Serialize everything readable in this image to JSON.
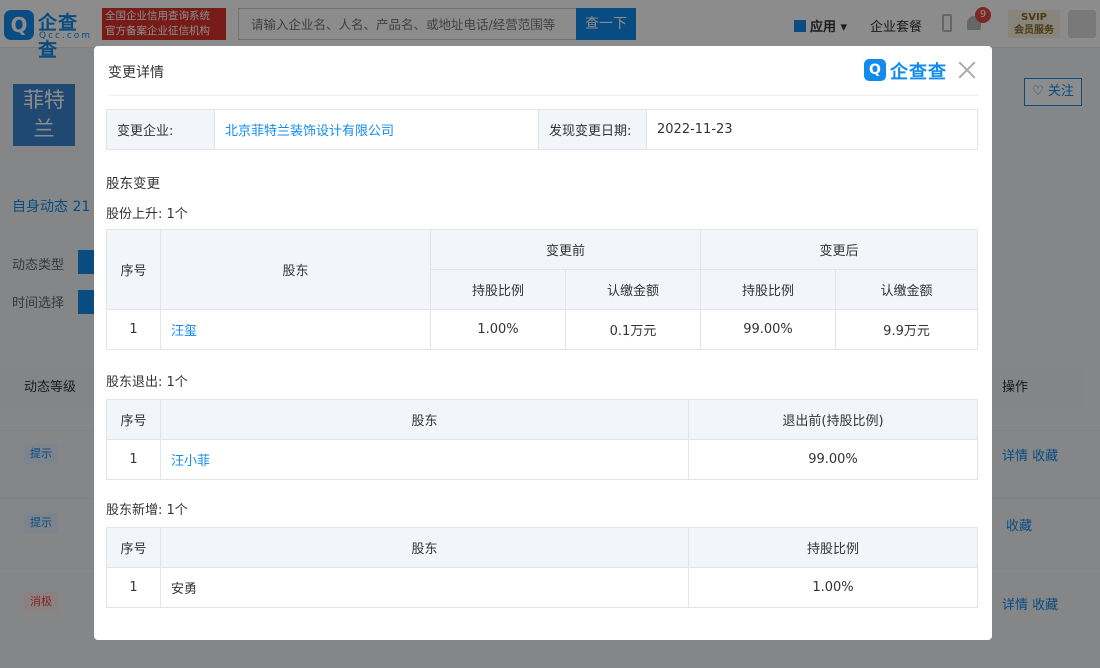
{
  "header": {
    "logo_mark": "Q",
    "logo_cn": "企查查",
    "logo_en": "Qcc.com",
    "badge_line1": "全国企业信用查询系统",
    "badge_line2": "官方备案企业征信机构",
    "search_placeholder": "请输入企业名、人名、产品名、或地址电话/经营范围等",
    "search_button": "查一下",
    "apps_label": "应用 ▾",
    "suite_label": "企业套餐",
    "notification_count": "9",
    "svip_line1": "SVIP",
    "svip_line2": "会员服务"
  },
  "company": {
    "logo_line1": "菲特",
    "logo_line2": "兰",
    "follow_label": "♡ 关注"
  },
  "background": {
    "self_tab": "自身动态 21",
    "filter_type_label": "动态类型",
    "filter_time_label": "时间选择",
    "col_level": "动态等级",
    "col_action": "操作",
    "rows": [
      {
        "level": "提示",
        "actions": "详情 收藏"
      },
      {
        "level": "提示",
        "actions": "收藏"
      },
      {
        "level": "消极",
        "actions": "详情 收藏"
      }
    ]
  },
  "modal": {
    "title": "变更详情",
    "brand_mark": "Q",
    "brand_text": "企查查",
    "info": {
      "company_label": "变更企业:",
      "company_value": "北京菲特兰装饰设计有限公司",
      "date_label": "发现变更日期:",
      "date_value": "2022-11-23"
    },
    "section_title": "股东变更",
    "increase": {
      "title": "股份上升: 1个",
      "col_no": "序号",
      "col_holder": "股东",
      "col_before": "变更前",
      "col_after": "变更后",
      "col_ratio": "持股比例",
      "col_amount": "认缴金额",
      "rows": [
        {
          "no": "1",
          "holder": "汪玺",
          "before_ratio": "1.00%",
          "before_amount": "0.1万元",
          "after_ratio": "99.00%",
          "after_amount": "9.9万元"
        }
      ]
    },
    "exit": {
      "title": "股东退出: 1个",
      "col_no": "序号",
      "col_holder": "股东",
      "col_ratio": "退出前(持股比例)",
      "rows": [
        {
          "no": "1",
          "holder": "汪小菲",
          "ratio": "99.00%"
        }
      ]
    },
    "added": {
      "title": "股东新增: 1个",
      "col_no": "序号",
      "col_holder": "股东",
      "col_ratio": "持股比例",
      "rows": [
        {
          "no": "1",
          "holder": "安勇",
          "ratio": "1.00%"
        }
      ]
    }
  }
}
